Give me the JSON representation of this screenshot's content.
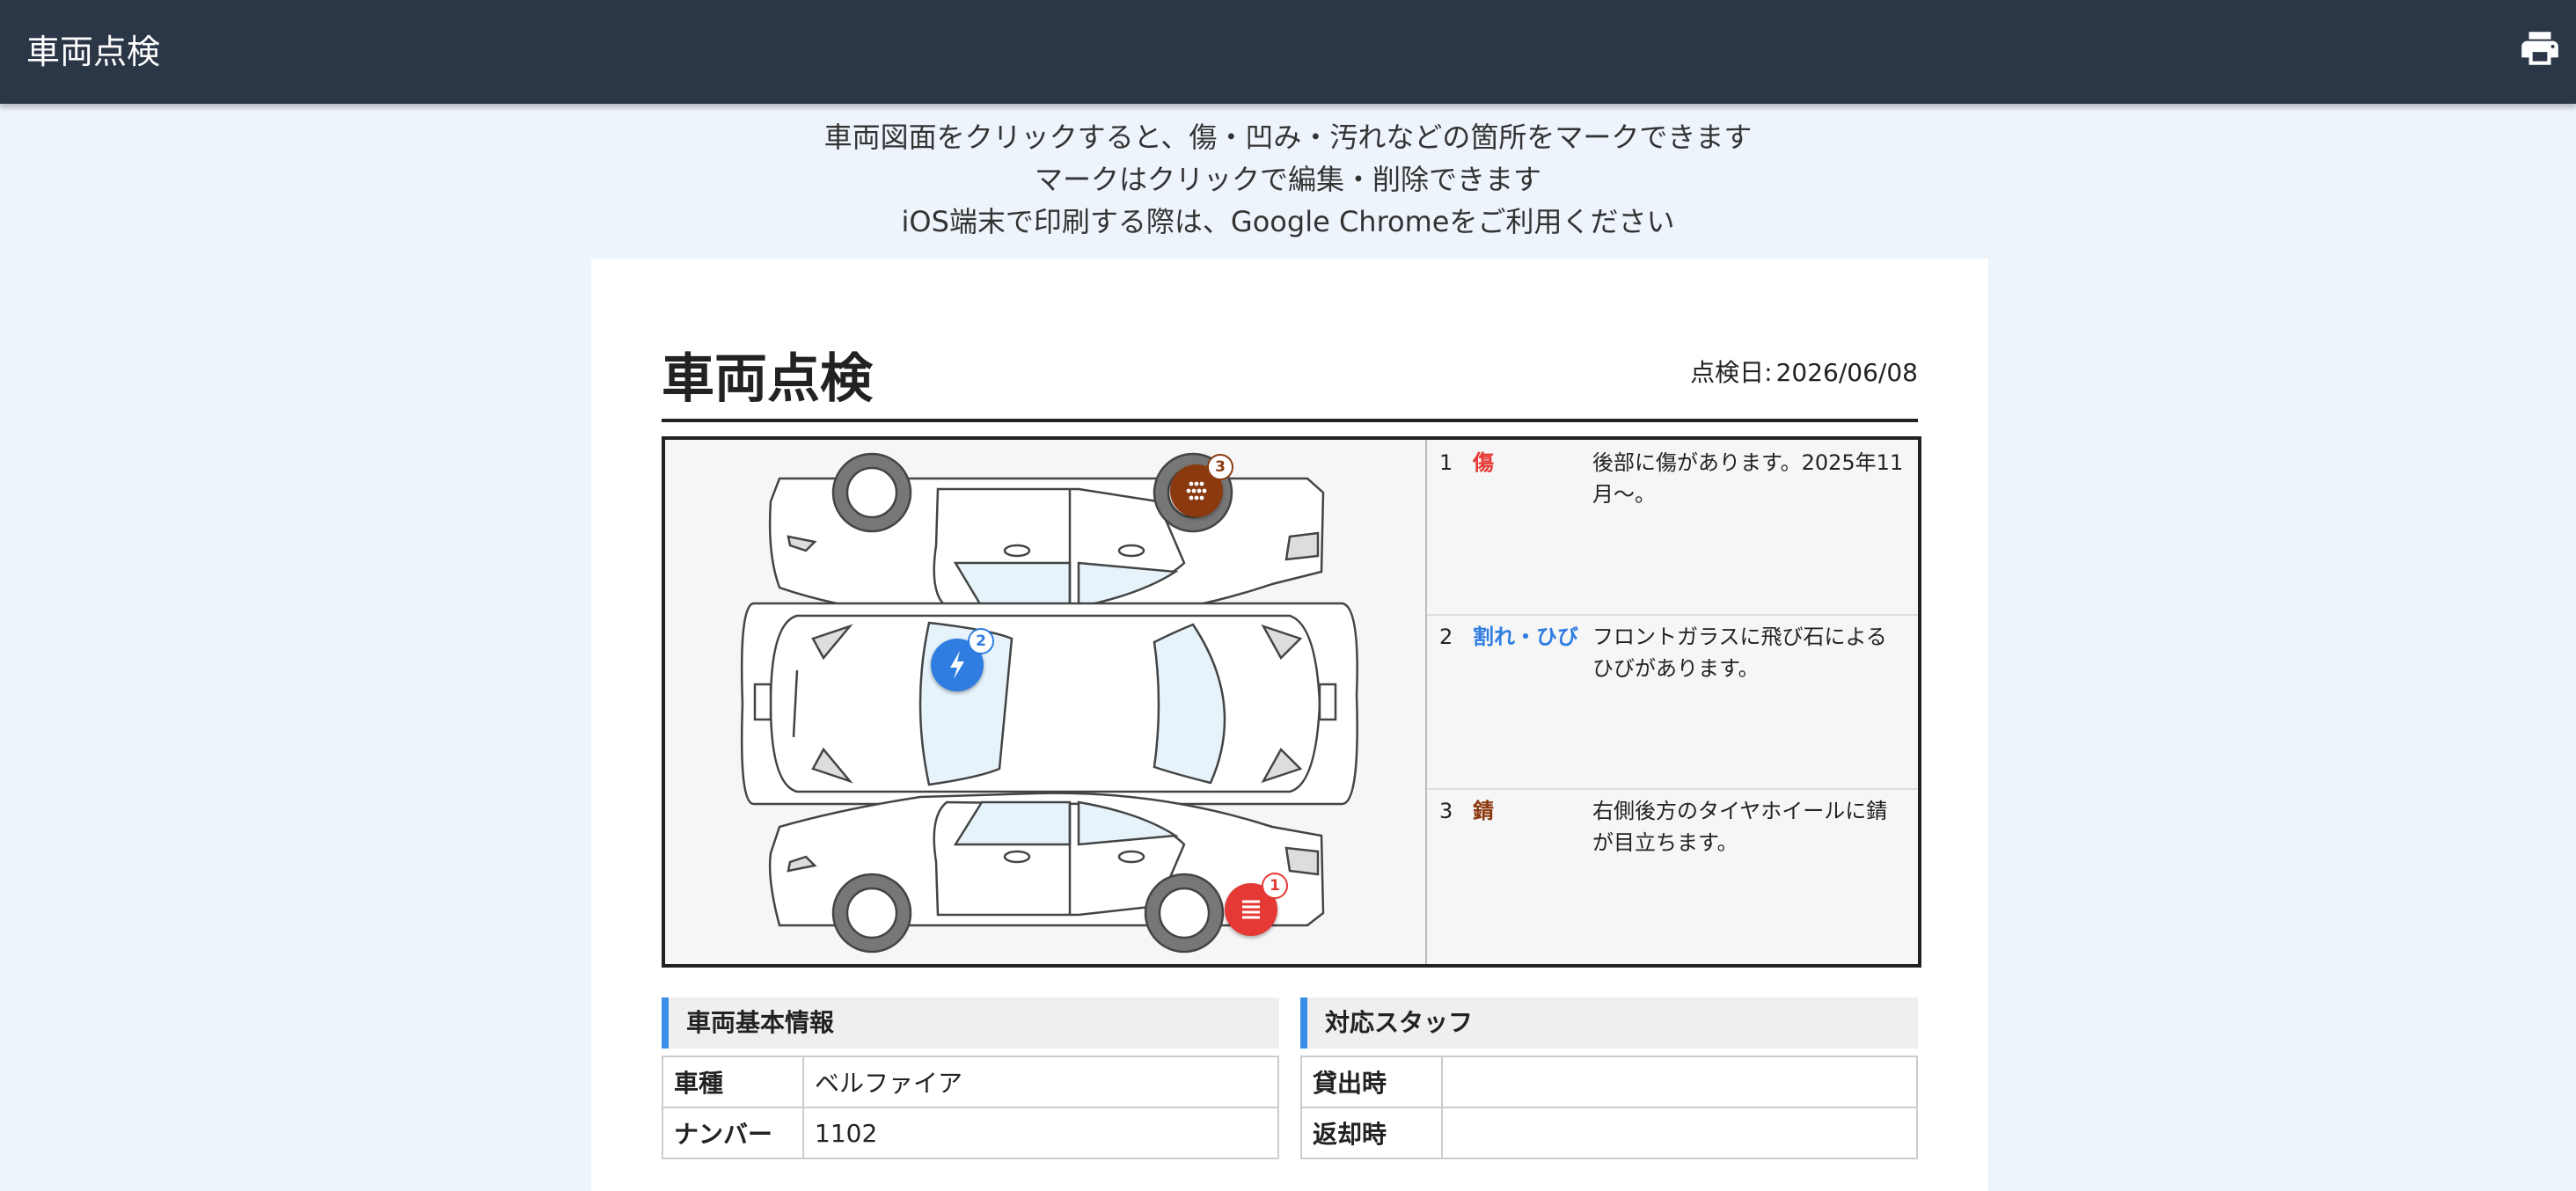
{
  "app": {
    "title": "車両点検"
  },
  "icons": {
    "print": "printer-icon"
  },
  "instructions": [
    "車両図面をクリックすると、傷・凹み・汚れなどの箇所をマークできます",
    "マークはクリックで編集・削除できます",
    "iOS端末で印刷する際は、Google Chromeをご利用ください"
  ],
  "document": {
    "title": "車両点検",
    "date_label": "点検日:",
    "date_value": "2026/06/08"
  },
  "colors": {
    "topbar": "#2b3647",
    "accent": "#3a8ee8",
    "scratch": "#e53935",
    "crack": "#2f7de1",
    "rust": "#8b3a10"
  },
  "markers": [
    {
      "num": "1",
      "type": "傷",
      "icon": "scratch-lines-icon",
      "color": "#e53935"
    },
    {
      "num": "2",
      "type": "割れ・ひび",
      "icon": "lightning-icon",
      "color": "#2f7de1"
    },
    {
      "num": "3",
      "type": "錆",
      "icon": "rust-dots-icon",
      "color": "#8b3a10"
    }
  ],
  "notes": [
    {
      "num": "1",
      "type": "傷",
      "desc": "後部に傷があります。2025年11月〜。"
    },
    {
      "num": "2",
      "type": "割れ・ひび",
      "desc": "フロントガラスに飛び石によるひびがあります。"
    },
    {
      "num": "3",
      "type": "錆",
      "desc": "右側後方のタイヤホイールに錆が目立ちます。"
    }
  ],
  "vehicle_info": {
    "heading": "車両基本情報",
    "rows": [
      {
        "key": "車種",
        "value": "ベルファイア"
      },
      {
        "key": "ナンバー",
        "value": "1102"
      }
    ]
  },
  "staff": {
    "heading": "対応スタッフ",
    "rows": [
      {
        "key": "貸出時",
        "value": ""
      },
      {
        "key": "返却時",
        "value": ""
      }
    ]
  }
}
